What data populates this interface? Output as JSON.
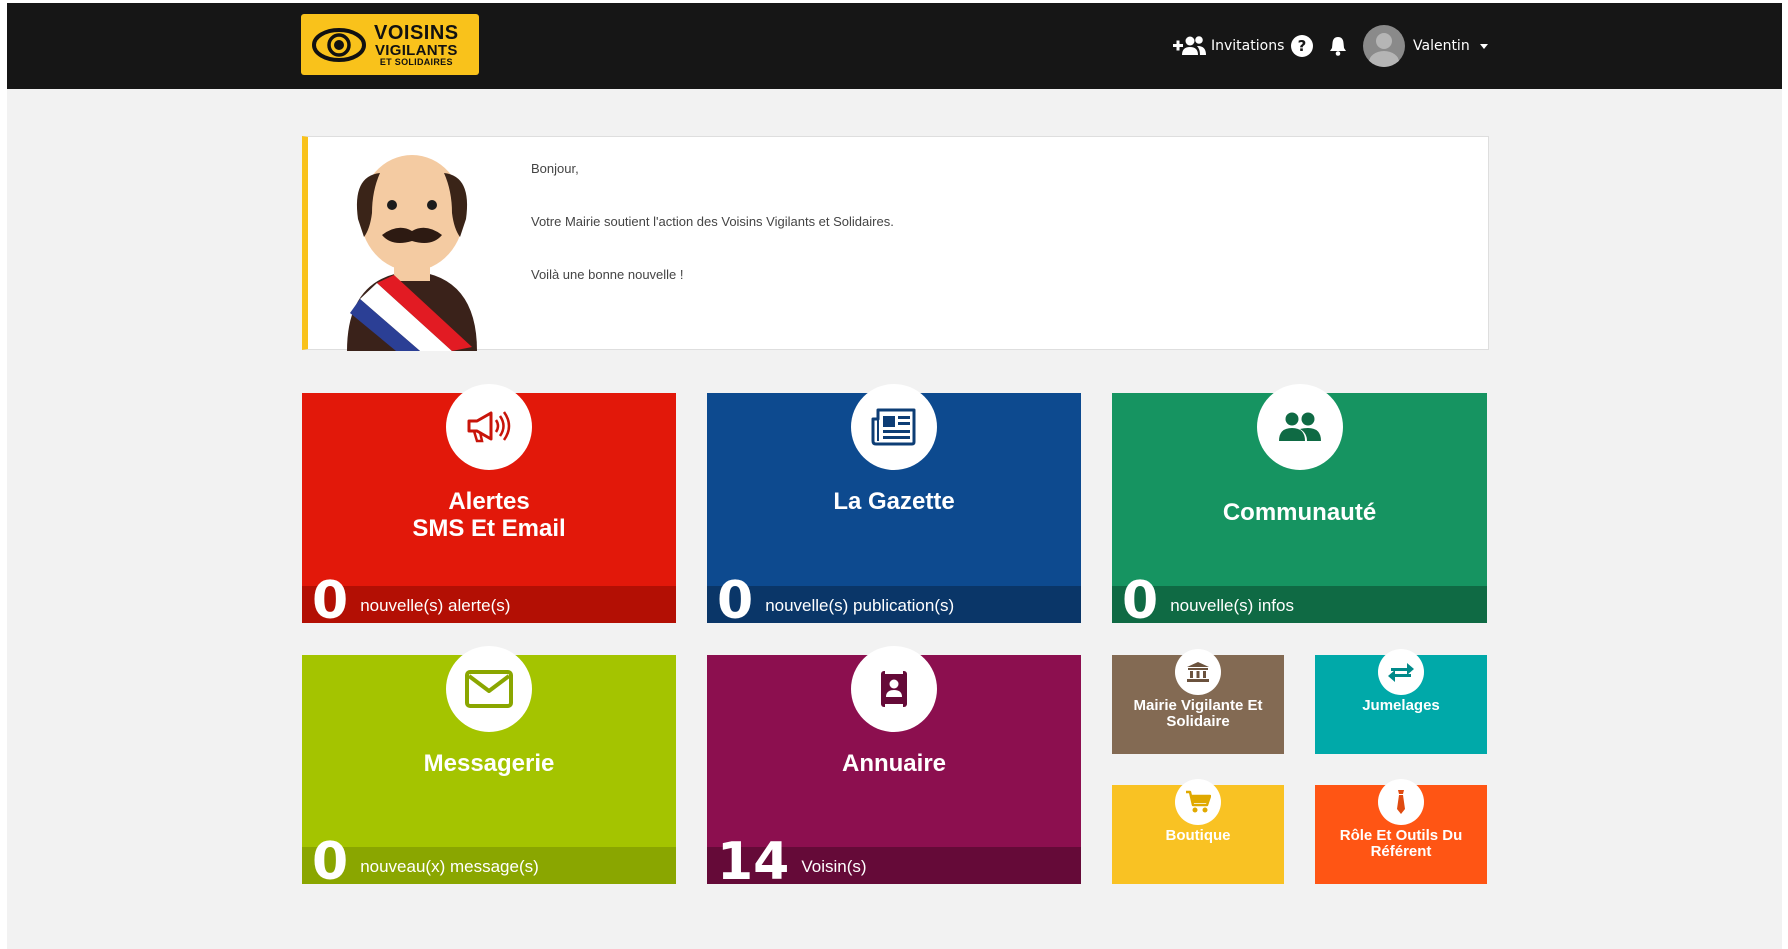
{
  "header": {
    "logo": {
      "line1": "VOISINS",
      "line2": "VIGILANTS",
      "line3": "ET SOLIDAIRES"
    },
    "invitations_label": "Invitations",
    "help_label": "?",
    "user_name": "Valentin"
  },
  "welcome": {
    "greeting": "Bonjour,",
    "message": "Votre Mairie soutient l'action des Voisins Vigilants et Solidaires.",
    "note": "Voilà une bonne nouvelle !"
  },
  "tiles": {
    "alertes": {
      "title_line1": "Alertes",
      "title_line2": "SMS Et Email",
      "count": "0",
      "label": "nouvelle(s) alerte(s)",
      "color": "#e2180a",
      "footer_color": "#b30f04",
      "icon": "megaphone-icon"
    },
    "gazette": {
      "title": "La Gazette",
      "count": "0",
      "label": "nouvelle(s) publication(s)",
      "color": "#0d4a8f",
      "footer_color": "#0a3668",
      "icon": "newspaper-icon"
    },
    "communaute": {
      "title": "Communauté",
      "count": "0",
      "label": "nouvelle(s) infos",
      "color": "#169461",
      "footer_color": "#0f6a44",
      "icon": "people-icon"
    },
    "messagerie": {
      "title": "Messagerie",
      "count": "0",
      "label": "nouveau(x) message(s)",
      "color": "#a4c400",
      "footer_color": "#8aa600",
      "icon": "envelope-icon"
    },
    "annuaire": {
      "title": "Annuaire",
      "count": "14",
      "label": "Voisin(s)",
      "color": "#8c0f4f",
      "footer_color": "#650a38",
      "icon": "contact-book-icon"
    },
    "mairie": {
      "title": "Mairie Vigilante Et Solidaire",
      "color": "#836a53",
      "icon": "town-hall-icon"
    },
    "jumelages": {
      "title": "Jumelages",
      "color": "#00a9a9",
      "icon": "exchange-arrows-icon"
    },
    "boutique": {
      "title": "Boutique",
      "color": "#f9c223",
      "icon": "cart-icon"
    },
    "referent": {
      "title": "Rôle Et Outils Du Référent",
      "color": "#ff5514",
      "icon": "tie-icon"
    }
  }
}
